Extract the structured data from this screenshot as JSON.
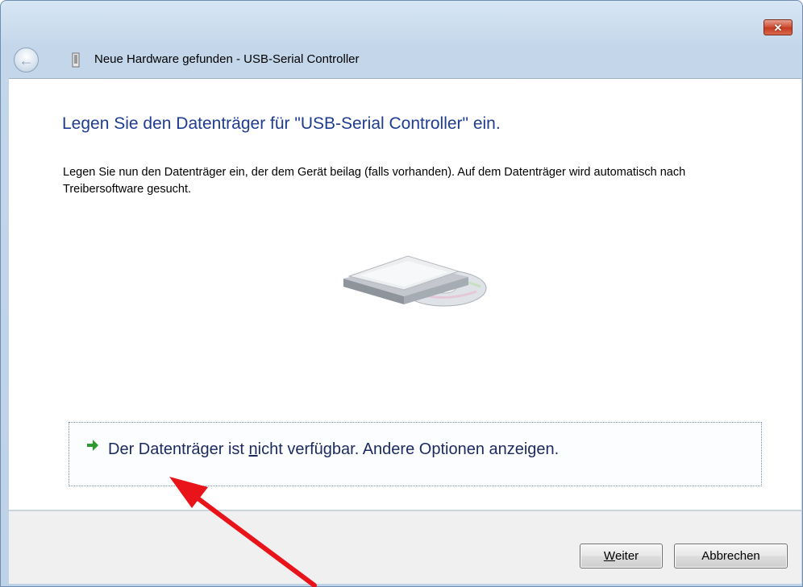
{
  "window": {
    "title": "Neue Hardware gefunden - USB-Serial Controller",
    "close_label": "✕"
  },
  "main": {
    "instruction": "Legen Sie den Datenträger für \"USB-Serial Controller\" ein.",
    "description": "Legen Sie nun den Datenträger ein, der dem Gerät beilag (falls vorhanden). Auf dem Datenträger wird automatisch nach Treibersoftware gesucht.",
    "option": {
      "before": "Der Datenträger ist ",
      "accel": "n",
      "after": "icht verfügbar. Andere Optionen anzeigen."
    }
  },
  "footer": {
    "next_accel": "W",
    "next_rest": "eiter",
    "cancel_label": "Abbrechen"
  },
  "colors": {
    "instruction_text": "#1e3d92",
    "annotation_arrow": "#e8141a",
    "link_arrow": "#2e9a2e"
  },
  "icons": [
    "back-arrow-icon",
    "usb-device-icon",
    "close-icon",
    "green-arrow-icon",
    "disc-drive-illustration"
  ]
}
